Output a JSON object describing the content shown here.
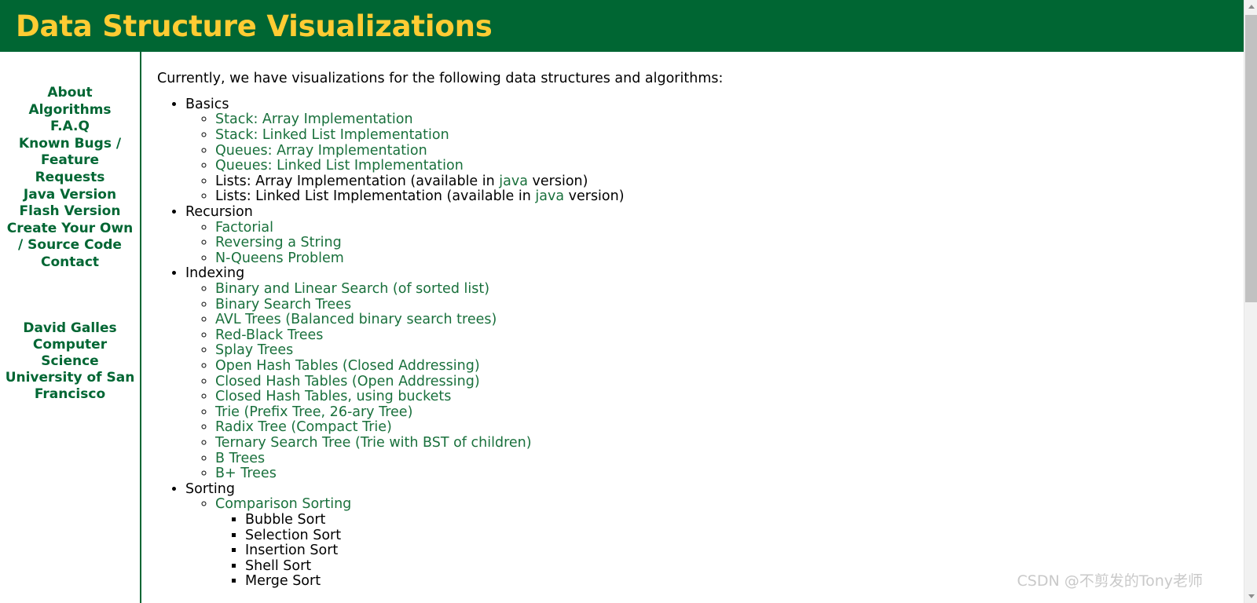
{
  "header": {
    "title": "Data Structure Visualizations",
    "bg_color": "#006633",
    "title_color": "#ffcc33"
  },
  "sidebar": {
    "link_color": "#006633",
    "items": [
      {
        "label": "About"
      },
      {
        "label": "Algorithms"
      },
      {
        "label": "F.A.Q"
      },
      {
        "label": "Known Bugs / Feature Requests"
      },
      {
        "label": "Java Version"
      },
      {
        "label": "Flash Version"
      },
      {
        "label": "Create Your Own / Source Code"
      },
      {
        "label": "Contact"
      }
    ],
    "attribution": {
      "name": "David Galles",
      "department": "Computer Science",
      "institution": "University of San Francisco"
    }
  },
  "main": {
    "intro": "Currently, we have visualizations for the following data structures and algorithms:",
    "link_color": "#19703c",
    "sections": [
      {
        "title": "Basics",
        "items": [
          {
            "type": "link",
            "text": "Stack: Array Implementation"
          },
          {
            "type": "link",
            "text": "Stack: Linked List Implementation"
          },
          {
            "type": "link",
            "text": "Queues: Array Implementation"
          },
          {
            "type": "link",
            "text": "Queues: Linked List Implementation"
          },
          {
            "type": "mixed",
            "prefix": "Lists: Array Implementation (available in ",
            "link": "java",
            "suffix": " version)"
          },
          {
            "type": "mixed",
            "prefix": "Lists: Linked List Implementation (available in ",
            "link": "java",
            "suffix": " version)"
          }
        ]
      },
      {
        "title": "Recursion",
        "items": [
          {
            "type": "link",
            "text": "Factorial"
          },
          {
            "type": "link",
            "text": "Reversing a String"
          },
          {
            "type": "link",
            "text": "N-Queens Problem"
          }
        ]
      },
      {
        "title": "Indexing",
        "items": [
          {
            "type": "link",
            "text": "Binary and Linear Search (of sorted list)"
          },
          {
            "type": "link",
            "text": "Binary Search Trees"
          },
          {
            "type": "link",
            "text": "AVL Trees (Balanced binary search trees)"
          },
          {
            "type": "link",
            "text": "Red-Black Trees"
          },
          {
            "type": "link",
            "text": "Splay Trees"
          },
          {
            "type": "link",
            "text": "Open Hash Tables (Closed Addressing)"
          },
          {
            "type": "link",
            "text": "Closed Hash Tables (Open Addressing)"
          },
          {
            "type": "link",
            "text": "Closed Hash Tables, using buckets"
          },
          {
            "type": "link",
            "text": "Trie (Prefix Tree, 26-ary Tree)"
          },
          {
            "type": "link",
            "text": "Radix Tree (Compact Trie)"
          },
          {
            "type": "link",
            "text": "Ternary Search Tree (Trie with BST of children)"
          },
          {
            "type": "link",
            "text": "B Trees"
          },
          {
            "type": "link",
            "text": "B+ Trees"
          }
        ]
      },
      {
        "title": "Sorting",
        "items": [
          {
            "type": "link",
            "text": "Comparison Sorting",
            "children": [
              {
                "type": "plain",
                "text": "Bubble Sort"
              },
              {
                "type": "plain",
                "text": "Selection Sort"
              },
              {
                "type": "plain",
                "text": "Insertion Sort"
              },
              {
                "type": "plain",
                "text": "Shell Sort"
              },
              {
                "type": "plain",
                "text": "Merge Sort"
              }
            ]
          }
        ]
      }
    ]
  },
  "watermark": {
    "text": "CSDN @不剪发的Tony老师"
  },
  "scrollbar": {
    "up_arrow": "scroll-up-arrow",
    "down_arrow": "scroll-down-arrow",
    "thumb": "scroll-thumb"
  }
}
